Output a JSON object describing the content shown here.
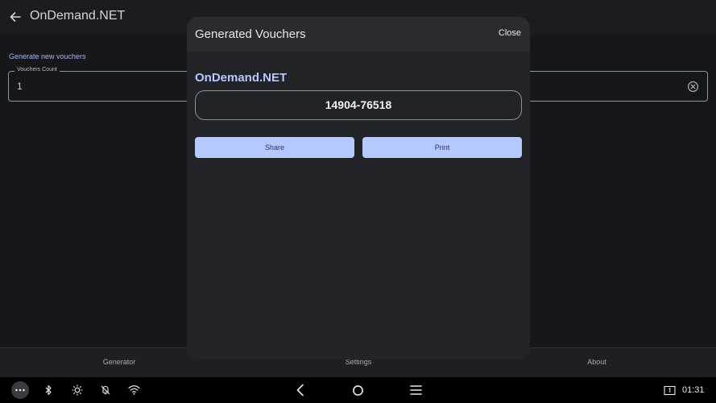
{
  "app_bar": {
    "title": "OnDemand.NET"
  },
  "main": {
    "section_label": "Generate new vouchers",
    "vouchers_count": {
      "label": "Vouchers Count",
      "value": "1"
    }
  },
  "bottom_nav": {
    "tabs": [
      {
        "label": "Generator"
      },
      {
        "label": "Settings"
      },
      {
        "label": "About"
      }
    ]
  },
  "dialog": {
    "title": "Generated Vouchers",
    "close_label": "Close",
    "org_name": "OnDemand.NET",
    "voucher_code": "14904-76518",
    "share_label": "Share",
    "print_label": "Print"
  },
  "system_bar": {
    "time": "01:31",
    "icons": [
      "more-icon",
      "bluetooth-icon",
      "brightness-icon",
      "mute-icon",
      "wifi-icon",
      "back-nav-icon",
      "home-nav-icon",
      "menu-nav-icon",
      "screen-icon"
    ]
  },
  "colors": {
    "accent": "#b5c8ff",
    "accent_text": "#2a3463",
    "background": "#16171b",
    "dialog": "#222327"
  }
}
